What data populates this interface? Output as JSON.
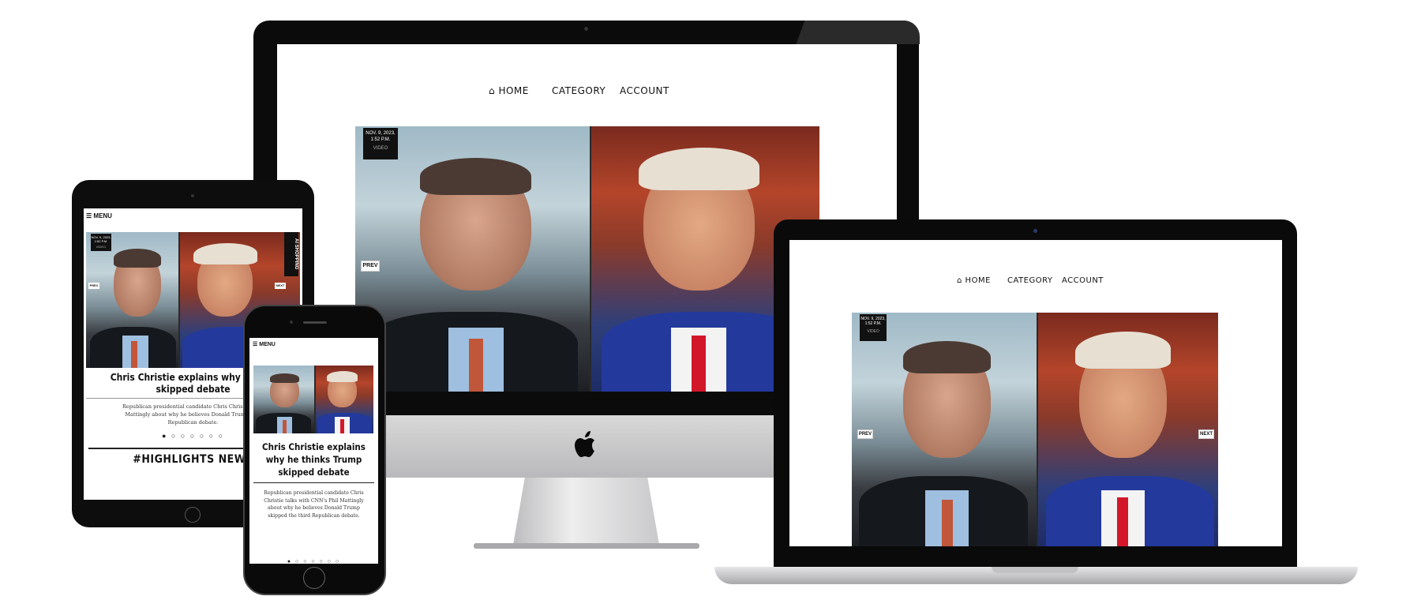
{
  "nav": {
    "home_label": "HOME",
    "category_label": "CATEGORY",
    "account_label": "ACCOUNT",
    "menu_label": "MENU"
  },
  "slide": {
    "date": "NOV. 9, 2023,",
    "time": "1:52 P.M.",
    "media_type": "VIDEO",
    "prev_label": "PREV",
    "next_label": "NEXT",
    "headline": "Chris Christie explains why he thinks Trump skipped debate",
    "headline_tablet_l1": "Chris Christie explains why he thir",
    "headline_tablet_l2": "skipped debate",
    "headline_phone_l1": "Chris Christie explains",
    "headline_phone_l2": "why he thinks Trump",
    "headline_phone_l3": "skipped debate",
    "summary": "Republican presidential candidate Chris Christie talks with CNN's Phil Mattingly about why he believes Donald Trump skipped the third Republican debate.",
    "summary_tablet_l1": "Republican presidential candidate Chris Christie talks",
    "summary_tablet_l2": "Mattingly about why he believes Donald Trump skip",
    "summary_tablet_l3": "Republican debate.",
    "summary_phone_l1": "Republican presidential candidate Chris",
    "summary_phone_l2": "Christie talks with CNN's Phil Mattingly",
    "summary_phone_l3": "about why he believes Donald Trump",
    "summary_phone_l4": "skipped the third Republican debate.",
    "pager": "● ○ ○ ○ ○ ○ ○",
    "vertical_label": "AI SHOPPING"
  },
  "section": {
    "highlights_label": "#HIGHLIGHTS NEWS"
  },
  "colors": {
    "accent": "#111111",
    "background": "#ffffff"
  },
  "icons": {
    "home": "home-icon",
    "menu": "hamburger-icon",
    "apple": "apple-logo-icon"
  }
}
